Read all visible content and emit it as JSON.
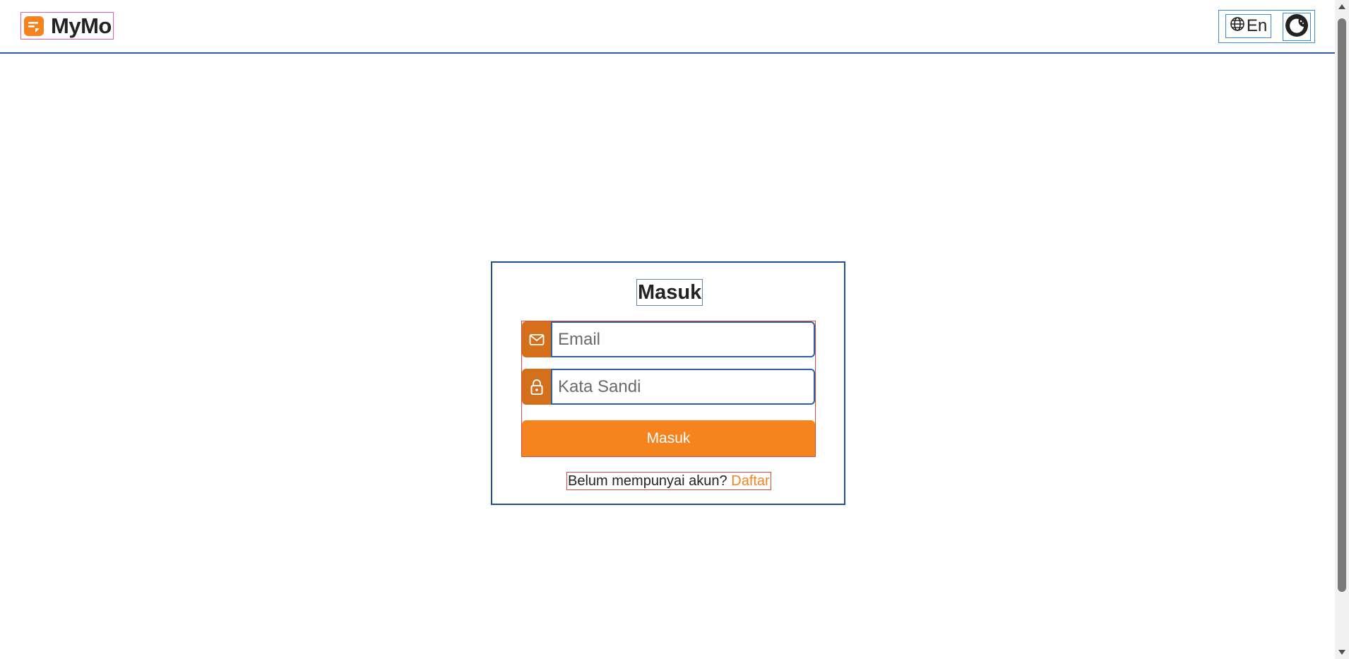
{
  "header": {
    "brand_name": "MyMo",
    "brand_icon": "note-icon",
    "language_label": "En",
    "language_icon": "globe-icon",
    "theme_icon": "moon-icon"
  },
  "login": {
    "title": "Masuk",
    "email_placeholder": "Email",
    "email_icon": "mail-icon",
    "password_placeholder": "Kata Sandi",
    "password_icon": "lock-icon",
    "submit_label": "Masuk",
    "signup_prompt": "Belum mempunyai akun?",
    "signup_link": "Daftar"
  },
  "colors": {
    "accent": "#f5841f",
    "icon_bg": "#d4701c",
    "border_blue": "#2b5fa8"
  }
}
